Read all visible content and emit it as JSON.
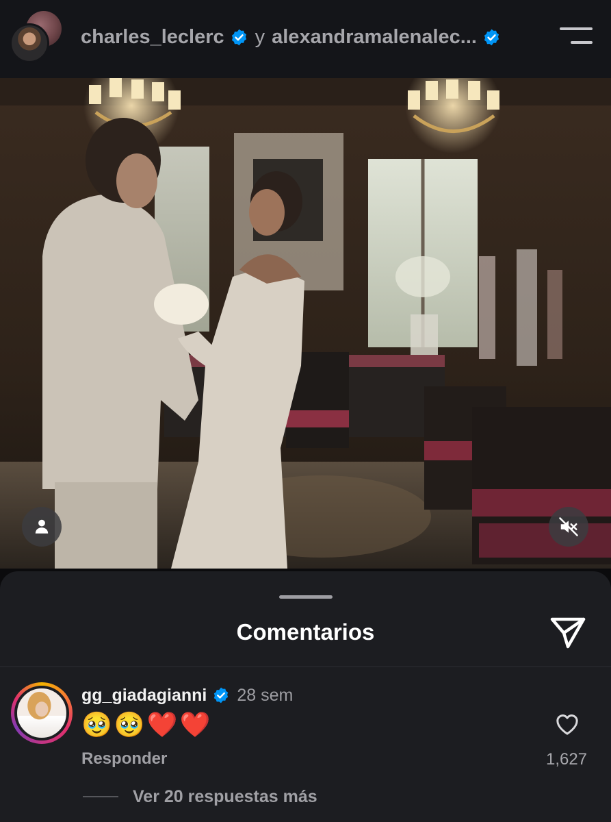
{
  "header": {
    "user1": "charles_leclerc",
    "connector": "y",
    "user2": "alexandramalenalec...",
    "icons": [
      "avatar-stack",
      "verified-badge-icon",
      "menu-icon"
    ]
  },
  "video": {
    "icons": [
      "user-tag-icon",
      "mute-icon"
    ]
  },
  "comments": {
    "title": "Comentarios",
    "share_icon": "send-icon",
    "items": [
      {
        "username": "gg_giadagianni",
        "verified": true,
        "time": "28 sem",
        "text": "🥹🥹❤️❤️",
        "reply_label": "Responder",
        "like_count": "1,627",
        "view_replies": "Ver 20 respuestas más"
      }
    ]
  },
  "colors": {
    "background": "#0b0b0d",
    "sheet": "#1c1d21",
    "verified_blue": "#0095f6",
    "muted_text": "#a0a0a5"
  }
}
